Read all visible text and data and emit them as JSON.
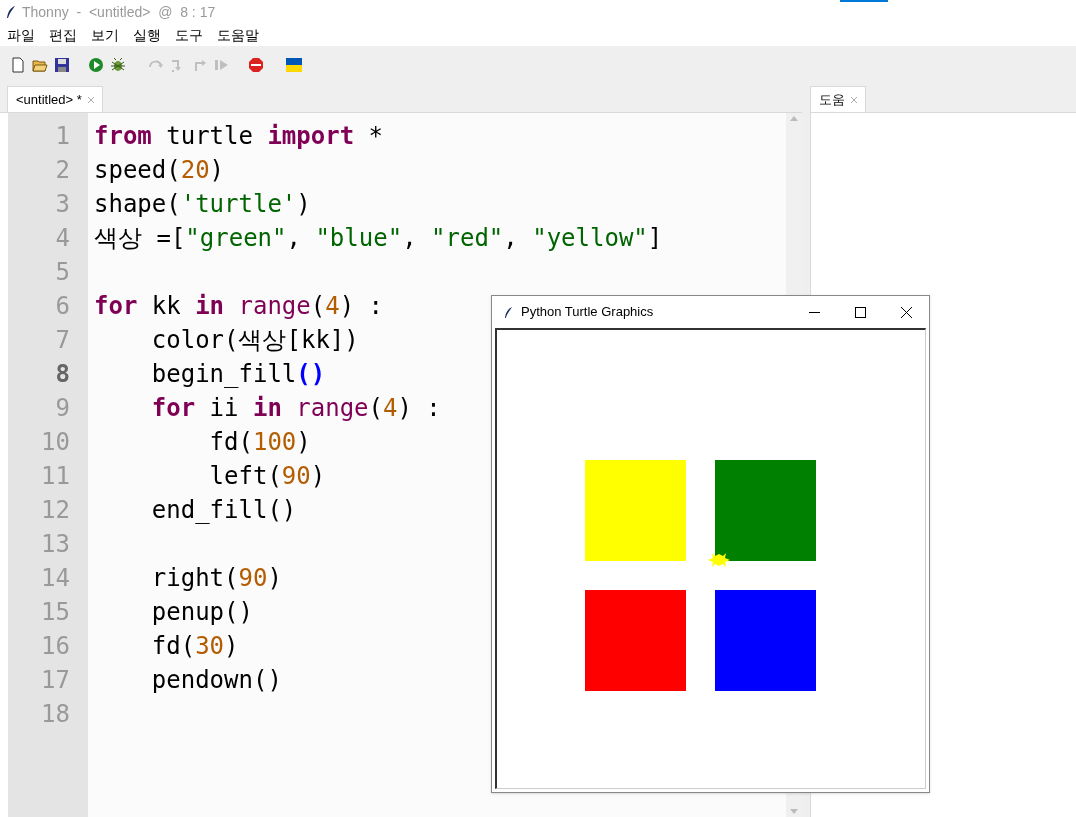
{
  "window": {
    "title": "Thonny  -  <untitled>  @  8 : 17"
  },
  "menu": [
    "파일",
    "편집",
    "보기",
    "실행",
    "도구",
    "도움말"
  ],
  "toolbar": [
    {
      "kind": "new",
      "disabled": false
    },
    {
      "kind": "open",
      "disabled": false
    },
    {
      "kind": "save",
      "disabled": false
    },
    {
      "kind": "run",
      "disabled": false
    },
    {
      "kind": "debug",
      "disabled": false
    },
    {
      "kind": "step-over",
      "disabled": true
    },
    {
      "kind": "step-into",
      "disabled": true
    },
    {
      "kind": "step-out",
      "disabled": true
    },
    {
      "kind": "resume",
      "disabled": true
    },
    {
      "kind": "stop",
      "disabled": false
    },
    {
      "kind": "flag",
      "disabled": false
    }
  ],
  "editor_tabs": [
    {
      "label": "<untitled> *",
      "selected": true
    }
  ],
  "help_tabs": [
    {
      "label": "도움",
      "selected": true
    }
  ],
  "code": [
    {
      "number": "1",
      "current": false,
      "tokens": [
        {
          "kind": "kw",
          "text": "from"
        },
        {
          "kind": "plain",
          "text": " turtle "
        },
        {
          "kind": "kw",
          "text": "import"
        },
        {
          "kind": "plain",
          "text": " *"
        }
      ]
    },
    {
      "number": "2",
      "current": false,
      "tokens": [
        {
          "kind": "plain",
          "text": "speed("
        },
        {
          "kind": "num",
          "text": "20"
        },
        {
          "kind": "plain",
          "text": ")"
        }
      ]
    },
    {
      "number": "3",
      "current": false,
      "tokens": [
        {
          "kind": "plain",
          "text": "shape("
        },
        {
          "kind": "str",
          "text": "'turtle'"
        },
        {
          "kind": "plain",
          "text": ")"
        }
      ]
    },
    {
      "number": "4",
      "current": false,
      "tokens": [
        {
          "kind": "plain",
          "text": "색상 =["
        },
        {
          "kind": "str",
          "text": "\"green\""
        },
        {
          "kind": "plain",
          "text": ", "
        },
        {
          "kind": "str",
          "text": "\"blue\""
        },
        {
          "kind": "plain",
          "text": ", "
        },
        {
          "kind": "str",
          "text": "\"red\""
        },
        {
          "kind": "plain",
          "text": ", "
        },
        {
          "kind": "str",
          "text": "\"yellow\""
        },
        {
          "kind": "plain",
          "text": "]"
        }
      ]
    },
    {
      "number": "5",
      "current": false
    },
    {
      "number": "6",
      "current": false,
      "tokens": [
        {
          "kind": "kw",
          "text": "for"
        },
        {
          "kind": "plain",
          "text": " kk "
        },
        {
          "kind": "kw",
          "text": "in"
        },
        {
          "kind": "builtin",
          "text": " range"
        },
        {
          "kind": "plain",
          "text": "("
        },
        {
          "kind": "num",
          "text": "4"
        },
        {
          "kind": "plain",
          "text": ") :"
        }
      ]
    },
    {
      "number": "7",
      "current": false,
      "tokens": [
        {
          "kind": "plain",
          "text": "    color(색상[kk])"
        }
      ]
    },
    {
      "number": "8",
      "current": true,
      "tokens": [
        {
          "kind": "plain",
          "text": "    begin_fill"
        },
        {
          "kind": "bracket",
          "text": "()"
        }
      ]
    },
    {
      "number": "9",
      "current": false,
      "tokens": [
        {
          "kind": "kw",
          "text": "    for"
        },
        {
          "kind": "plain",
          "text": " ii "
        },
        {
          "kind": "kw",
          "text": "in"
        },
        {
          "kind": "builtin",
          "text": " range"
        },
        {
          "kind": "plain",
          "text": "("
        },
        {
          "kind": "num",
          "text": "4"
        },
        {
          "kind": "plain",
          "text": ") :"
        }
      ]
    },
    {
      "number": "10",
      "current": false,
      "tokens": [
        {
          "kind": "plain",
          "text": "        fd("
        },
        {
          "kind": "num",
          "text": "100"
        },
        {
          "kind": "plain",
          "text": ")"
        }
      ]
    },
    {
      "number": "11",
      "current": false,
      "tokens": [
        {
          "kind": "plain",
          "text": "        left("
        },
        {
          "kind": "num",
          "text": "90"
        },
        {
          "kind": "plain",
          "text": ")"
        }
      ]
    },
    {
      "number": "12",
      "current": false,
      "tokens": [
        {
          "kind": "plain",
          "text": "    end_fill()"
        }
      ]
    },
    {
      "number": "13",
      "current": false
    },
    {
      "number": "14",
      "current": false,
      "tokens": [
        {
          "kind": "plain",
          "text": "    right("
        },
        {
          "kind": "num",
          "text": "90"
        },
        {
          "kind": "plain",
          "text": ")"
        }
      ]
    },
    {
      "number": "15",
      "current": false,
      "tokens": [
        {
          "kind": "plain",
          "text": "    penup()"
        }
      ]
    },
    {
      "number": "16",
      "current": false,
      "tokens": [
        {
          "kind": "plain",
          "text": "    fd("
        },
        {
          "kind": "num",
          "text": "30"
        },
        {
          "kind": "plain",
          "text": ")"
        }
      ]
    },
    {
      "number": "17",
      "current": false,
      "tokens": [
        {
          "kind": "plain",
          "text": "    pendown()"
        }
      ]
    },
    {
      "number": "18",
      "current": false
    }
  ],
  "turtle_window": {
    "title": "Python Turtle Graphics",
    "squares": [
      {
        "color": "#ffff00"
      },
      {
        "color": "#008000"
      },
      {
        "color": "#ff0000"
      },
      {
        "color": "#0000ff"
      }
    ]
  }
}
